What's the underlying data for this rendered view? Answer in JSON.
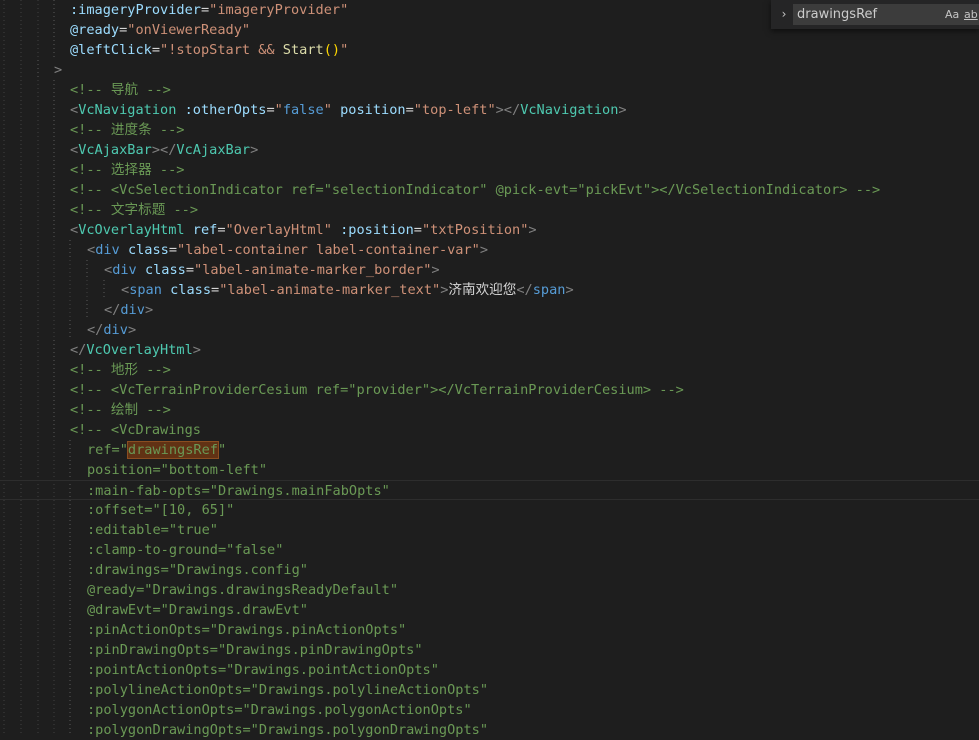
{
  "find_widget": {
    "value": "drawingsRef",
    "chevron_icon": "chevron-right-icon",
    "match_case_label": "Aa",
    "match_word_label": "ab",
    "regex_label": ".*"
  },
  "lines": [
    [
      {
        "t": ":imageryProvider",
        "c": "t-attr"
      },
      {
        "t": "=",
        "c": "t-txt"
      },
      {
        "t": "\"imageryProvider\"",
        "c": "t-str"
      }
    ],
    [
      {
        "t": "@ready",
        "c": "t-attr"
      },
      {
        "t": "=",
        "c": "t-txt"
      },
      {
        "t": "\"onViewerReady\"",
        "c": "t-str"
      }
    ],
    [
      {
        "t": "@leftClick",
        "c": "t-attr"
      },
      {
        "t": "=",
        "c": "t-txt"
      },
      {
        "t": "\"!stopStart && ",
        "c": "t-str"
      },
      {
        "t": "Start",
        "c": "t-fn"
      },
      {
        "t": "()",
        "c": "t-br"
      },
      {
        "t": "\"",
        "c": "t-str"
      }
    ],
    [
      {
        "t": ">",
        "c": "t-punc"
      }
    ],
    [
      {
        "t": "<!-- 导航 -->",
        "c": "t-com"
      }
    ],
    [
      {
        "t": "<",
        "c": "t-punc"
      },
      {
        "t": "VcNavigation",
        "c": "t-comp"
      },
      {
        "t": " ",
        "c": "t-txt"
      },
      {
        "t": ":otherOpts",
        "c": "t-attr"
      },
      {
        "t": "=",
        "c": "t-txt"
      },
      {
        "t": "\"",
        "c": "t-str"
      },
      {
        "t": "false",
        "c": "t-kw"
      },
      {
        "t": "\"",
        "c": "t-str"
      },
      {
        "t": " ",
        "c": "t-txt"
      },
      {
        "t": "position",
        "c": "t-attr"
      },
      {
        "t": "=",
        "c": "t-txt"
      },
      {
        "t": "\"top-left\"",
        "c": "t-str"
      },
      {
        "t": "></",
        "c": "t-punc"
      },
      {
        "t": "VcNavigation",
        "c": "t-comp"
      },
      {
        "t": ">",
        "c": "t-punc"
      }
    ],
    [
      {
        "t": "<!-- 进度条 -->",
        "c": "t-com"
      }
    ],
    [
      {
        "t": "<",
        "c": "t-punc"
      },
      {
        "t": "VcAjaxBar",
        "c": "t-comp"
      },
      {
        "t": "></",
        "c": "t-punc"
      },
      {
        "t": "VcAjaxBar",
        "c": "t-comp"
      },
      {
        "t": ">",
        "c": "t-punc"
      }
    ],
    [
      {
        "t": "<!-- 选择器 -->",
        "c": "t-com"
      }
    ],
    [
      {
        "t": "<!-- <VcSelectionIndicator ref=\"selectionIndicator\" @pick-evt=\"pickEvt\"></VcSelectionIndicator> -->",
        "c": "t-com"
      }
    ],
    [
      {
        "t": "<!-- 文字标题 -->",
        "c": "t-com"
      }
    ],
    [
      {
        "t": "<",
        "c": "t-punc"
      },
      {
        "t": "VcOverlayHtml",
        "c": "t-comp"
      },
      {
        "t": " ",
        "c": "t-txt"
      },
      {
        "t": "ref",
        "c": "t-attr"
      },
      {
        "t": "=",
        "c": "t-txt"
      },
      {
        "t": "\"OverlayHtml\"",
        "c": "t-str"
      },
      {
        "t": " ",
        "c": "t-txt"
      },
      {
        "t": ":position",
        "c": "t-attr"
      },
      {
        "t": "=",
        "c": "t-txt"
      },
      {
        "t": "\"txtPosition\"",
        "c": "t-str"
      },
      {
        "t": ">",
        "c": "t-punc"
      }
    ],
    [
      {
        "t": "<",
        "c": "t-punc"
      },
      {
        "t": "div",
        "c": "t-tag"
      },
      {
        "t": " ",
        "c": "t-txt"
      },
      {
        "t": "class",
        "c": "t-attr"
      },
      {
        "t": "=",
        "c": "t-txt"
      },
      {
        "t": "\"label-container label-container-var\"",
        "c": "t-str"
      },
      {
        "t": ">",
        "c": "t-punc"
      }
    ],
    [
      {
        "t": "<",
        "c": "t-punc"
      },
      {
        "t": "div",
        "c": "t-tag"
      },
      {
        "t": " ",
        "c": "t-txt"
      },
      {
        "t": "class",
        "c": "t-attr"
      },
      {
        "t": "=",
        "c": "t-txt"
      },
      {
        "t": "\"label-animate-marker_border\"",
        "c": "t-str"
      },
      {
        "t": ">",
        "c": "t-punc"
      }
    ],
    [
      {
        "t": "<",
        "c": "t-punc"
      },
      {
        "t": "span",
        "c": "t-tag"
      },
      {
        "t": " ",
        "c": "t-txt"
      },
      {
        "t": "class",
        "c": "t-attr"
      },
      {
        "t": "=",
        "c": "t-txt"
      },
      {
        "t": "\"label-animate-marker_text\"",
        "c": "t-str"
      },
      {
        "t": ">",
        "c": "t-punc"
      },
      {
        "t": "济南欢迎您",
        "c": "t-txt"
      },
      {
        "t": "</",
        "c": "t-punc"
      },
      {
        "t": "span",
        "c": "t-tag"
      },
      {
        "t": ">",
        "c": "t-punc"
      }
    ],
    [
      {
        "t": "</",
        "c": "t-punc"
      },
      {
        "t": "div",
        "c": "t-tag"
      },
      {
        "t": ">",
        "c": "t-punc"
      }
    ],
    [
      {
        "t": "</",
        "c": "t-punc"
      },
      {
        "t": "div",
        "c": "t-tag"
      },
      {
        "t": ">",
        "c": "t-punc"
      }
    ],
    [
      {
        "t": "</",
        "c": "t-punc"
      },
      {
        "t": "VcOverlayHtml",
        "c": "t-comp"
      },
      {
        "t": ">",
        "c": "t-punc"
      }
    ],
    [
      {
        "t": "<!-- 地形 -->",
        "c": "t-com"
      }
    ],
    [
      {
        "t": "<!-- <VcTerrainProviderCesium ref=\"provider\"></VcTerrainProviderCesium> -->",
        "c": "t-com"
      }
    ],
    [
      {
        "t": "<!-- 绘制 -->",
        "c": "t-com"
      }
    ],
    [
      {
        "t": "<!-- <VcDrawings",
        "c": "t-com"
      }
    ],
    [
      {
        "t": "ref=\"",
        "c": "t-com"
      },
      {
        "t": "drawingsRef",
        "c": "t-com",
        "hl": true
      },
      {
        "t": "\"",
        "c": "t-com"
      }
    ],
    [
      {
        "t": "position=\"bottom-left\"",
        "c": "t-com"
      }
    ],
    [
      {
        "t": ":main-fab-opts=\"Drawings.mainFabOpts\"",
        "c": "t-com"
      }
    ],
    [
      {
        "t": ":offset=\"[10, 65]\"",
        "c": "t-com"
      }
    ],
    [
      {
        "t": ":editable=\"true\"",
        "c": "t-com"
      }
    ],
    [
      {
        "t": ":clamp-to-ground=\"false\"",
        "c": "t-com"
      }
    ],
    [
      {
        "t": ":drawings=\"Drawings.config\"",
        "c": "t-com"
      }
    ],
    [
      {
        "t": "@ready=\"Drawings.drawingsReadyDefault\"",
        "c": "t-com"
      }
    ],
    [
      {
        "t": "@drawEvt=\"Drawings.drawEvt\"",
        "c": "t-com"
      }
    ],
    [
      {
        "t": ":pinActionOpts=\"Drawings.pinActionOpts\"",
        "c": "t-com"
      }
    ],
    [
      {
        "t": ":pinDrawingOpts=\"Drawings.pinDrawingOpts\"",
        "c": "t-com"
      }
    ],
    [
      {
        "t": ":pointActionOpts=\"Drawings.pointActionOpts\"",
        "c": "t-com"
      }
    ],
    [
      {
        "t": ":polylineActionOpts=\"Drawings.polylineActionOpts\"",
        "c": "t-com"
      }
    ],
    [
      {
        "t": ":polygonActionOpts=\"Drawings.polygonActionOpts\"",
        "c": "t-com"
      }
    ],
    [
      {
        "t": ":polygonDrawingOpts=\"Drawings.polygonDrawingOpts\"",
        "c": "t-com"
      }
    ]
  ]
}
